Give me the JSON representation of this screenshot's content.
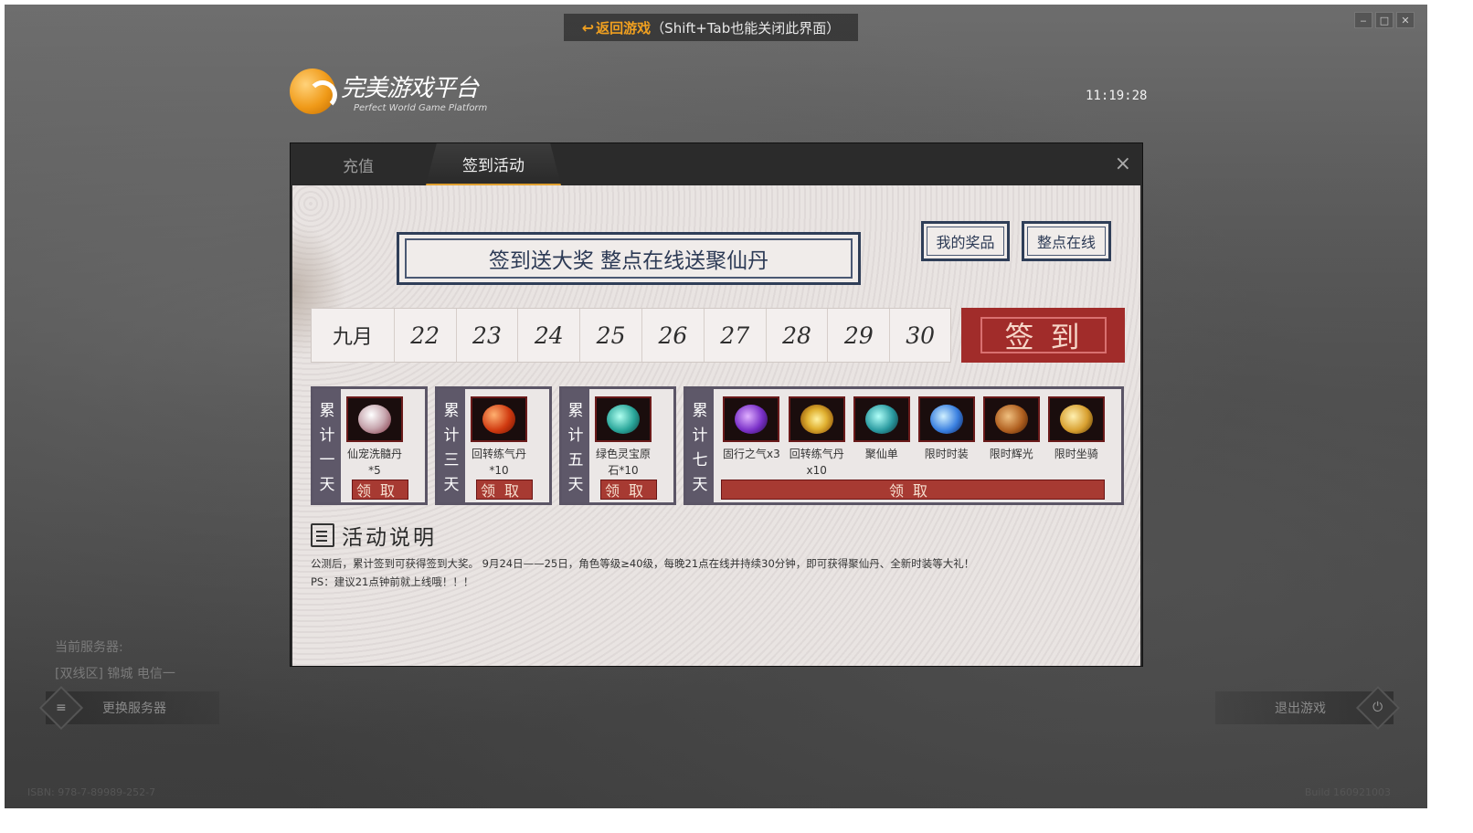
{
  "topbar": {
    "return_label": "返回游戏",
    "hint": "（Shift+Tab也能关闭此界面）"
  },
  "window_controls": [
    "minimize-icon",
    "maximize-icon",
    "close-icon"
  ],
  "logo": {
    "main": "完美游戏平台",
    "sub": "Perfect World Game Platform"
  },
  "clock": "11:19:28",
  "dialog": {
    "tabs": [
      {
        "label": "充值",
        "active": false
      },
      {
        "label": "签到活动",
        "active": true
      }
    ],
    "close": "×"
  },
  "banner": "签到送大奖 整点在线送聚仙丹",
  "buttons": {
    "my_prizes": "我的奖品",
    "hourly_online": "整点在线"
  },
  "calendar": {
    "month": "九月",
    "days": [
      "22",
      "23",
      "24",
      "25",
      "26",
      "27",
      "28",
      "29",
      "30"
    ]
  },
  "sign_button": "签到",
  "rewards": [
    {
      "side": [
        "累",
        "计",
        "一",
        "天"
      ],
      "items": [
        {
          "label": "仙宠洗髓丹",
          "qty": "*5",
          "color": "#e6e0e0",
          "icon": "pet-pill-icon"
        }
      ],
      "claim": "领取"
    },
    {
      "side": [
        "累",
        "计",
        "三",
        "天"
      ],
      "items": [
        {
          "label": "回转练气丹",
          "qty": "*10",
          "color": "#d03a10",
          "icon": "red-orb-icon"
        }
      ],
      "claim": "领取"
    },
    {
      "side": [
        "累",
        "计",
        "五",
        "天"
      ],
      "items": [
        {
          "label": "绿色灵宝原",
          "qty": "石*10",
          "color": "#2aa69a",
          "icon": "green-stone-icon"
        }
      ],
      "claim": "领取"
    },
    {
      "side": [
        "累",
        "计",
        "七",
        "天"
      ],
      "items": [
        {
          "label": "固行之气x3",
          "qty": "",
          "color": "#7a30c8",
          "icon": "purple-qi-icon"
        },
        {
          "label": "回转练气丹",
          "qty": "x10",
          "color": "#e0b030",
          "icon": "golden-ring-icon"
        },
        {
          "label": "聚仙单",
          "qty": "",
          "color": "#2a9aa0",
          "icon": "teal-gem-icon"
        },
        {
          "label": "限时时装",
          "qty": "",
          "color": "#3a80e0",
          "icon": "blue-orb-icon"
        },
        {
          "label": "限时辉光",
          "qty": "",
          "color": "#b06020",
          "icon": "brown-bag-icon"
        },
        {
          "label": "限时坐骑",
          "qty": "",
          "color": "#d8a030",
          "icon": "gold-bag-icon"
        }
      ],
      "claim": "领取"
    }
  ],
  "description": {
    "title": "活动说明",
    "line1": "公测后，累计签到可获得签到大奖。 9月24日——25日，角色等级≥40级，每晚21点在线并持续30分钟，即可获得聚仙丹、全新时装等大礼！",
    "line2": "PS：建议21点钟前就上线哦！！！"
  },
  "server": {
    "label": "当前服务器:",
    "name": "[双线区] 锦城  电信一",
    "change": "更换服务器"
  },
  "exit": "退出游戏",
  "isbn": "ISBN: 978-7-89989-252-7",
  "build": "Build 160921003"
}
